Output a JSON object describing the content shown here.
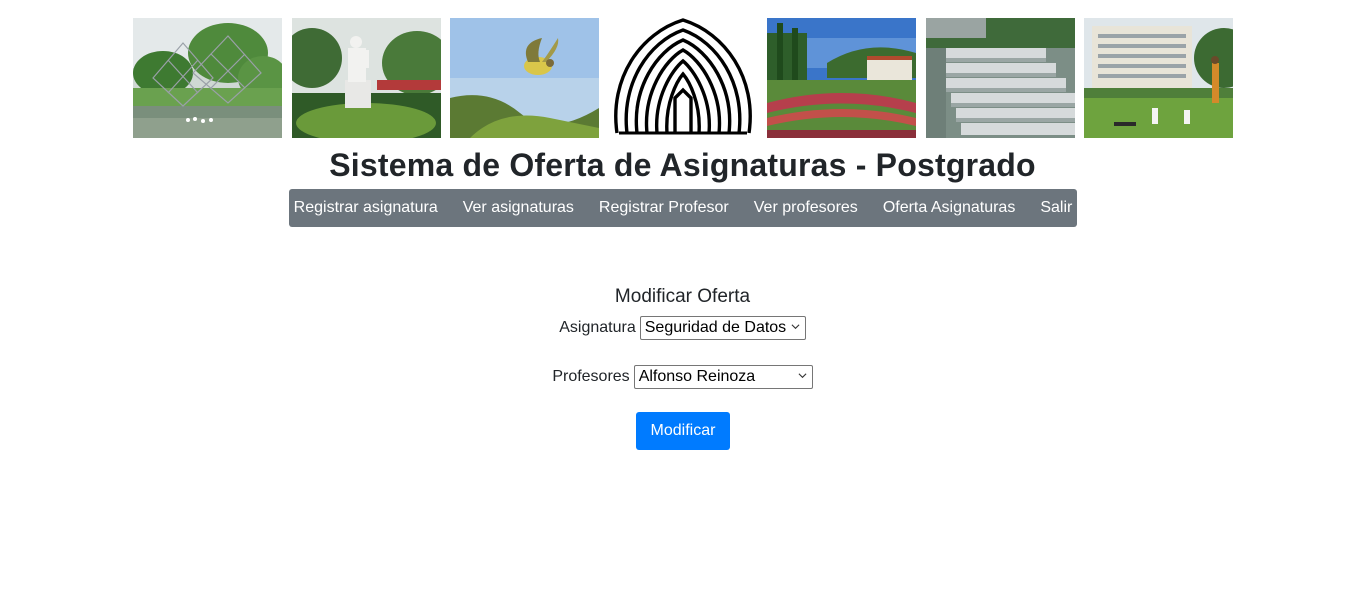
{
  "header": {
    "title": "Sistema de Oferta de Asignaturas - Postgrado",
    "banner_photos": [
      "lake-sculpture-photo",
      "statue-photo",
      "bird-photo",
      "logo-emblem",
      "garden-building-photo",
      "fountain-photo",
      "campus-lawn-photo"
    ]
  },
  "nav": {
    "items": [
      {
        "label": "Registrar asignatura"
      },
      {
        "label": "Ver asignaturas"
      },
      {
        "label": "Registrar Profesor"
      },
      {
        "label": "Ver profesores"
      },
      {
        "label": "Oferta Asignaturas"
      },
      {
        "label": "Salir"
      }
    ]
  },
  "form": {
    "title": "Modificar Oferta",
    "asignatura_label": "Asignatura",
    "asignatura_value": "Seguridad de Datos",
    "profesores_label": "Profesores",
    "profesores_value": "Alfonso Reinoza",
    "submit_label": "Modificar"
  },
  "colors": {
    "navbar": "#6c757d",
    "button": "#007bff",
    "text": "#212529"
  }
}
